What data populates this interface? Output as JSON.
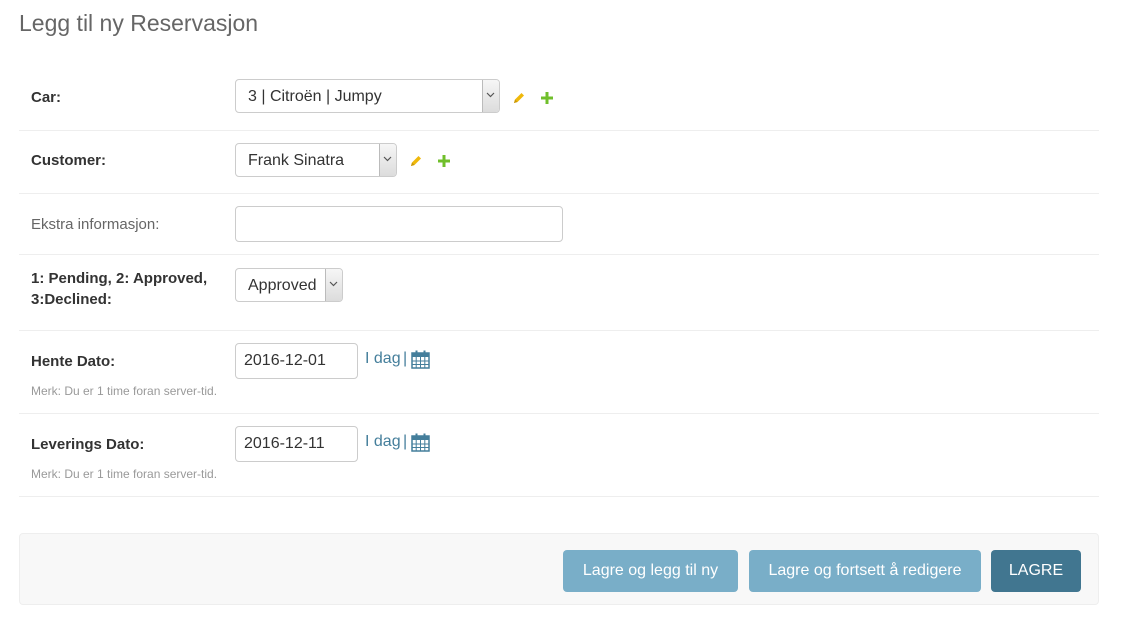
{
  "page": {
    "title": "Legg til ny Reservasjon"
  },
  "fields": {
    "car": {
      "label": "Car:",
      "value": "3 | Citroën | Jumpy"
    },
    "customer": {
      "label": "Customer:",
      "value": "Frank Sinatra"
    },
    "extra": {
      "label": "Ekstra informasjon:",
      "value": ""
    },
    "status": {
      "label_line1": "1: Pending, 2: Approved,",
      "label_line2": "3:Declined:",
      "value": "Approved"
    },
    "pickup": {
      "label": "Hente Dato:",
      "value": "2016-12-01",
      "today": "I dag",
      "sep": "|",
      "help": "Merk: Du er 1 time foran server-tid."
    },
    "delivery": {
      "label": "Leverings Dato:",
      "value": "2016-12-11",
      "today": "I dag",
      "sep": "|",
      "help": "Merk: Du er 1 time foran server-tid."
    }
  },
  "buttons": {
    "save_add": "Lagre og legg til ny",
    "save_continue": "Lagre og fortsett å redigere",
    "save": "LAGRE"
  },
  "icons": {
    "edit": "pencil-icon",
    "add": "plus-icon",
    "calendar": "calendar-icon",
    "dropdown": "chevron-down-icon"
  },
  "colors": {
    "link": "#447e9b",
    "button_light": "#79aec8",
    "button_dark": "#417690",
    "edit_icon": "#efb80b",
    "add_icon": "#70bf2b"
  }
}
